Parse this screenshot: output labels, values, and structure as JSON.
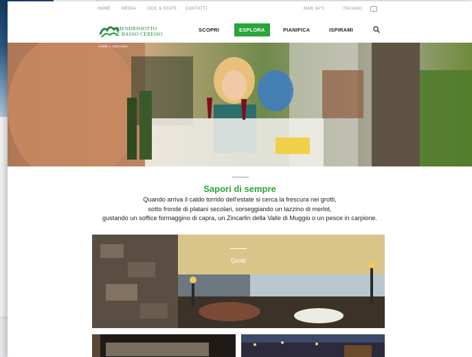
{
  "topbar": {
    "links": [
      "HOME",
      "MEDIA",
      "DOC & STATE",
      "CONTATTI"
    ],
    "weather": "MAR 24°C",
    "language": "ITALIANO"
  },
  "header": {
    "logo_line1": "MENDRISIOTTO",
    "logo_line2": "E BASSO CERESIO",
    "nav": [
      "SCOPRI",
      "ESPLORA",
      "PIANIFICA",
      "ISPIRAMI"
    ],
    "active_nav": "ESPLORA"
  },
  "breadcrumb": [
    "HOME",
    "ESPLORA"
  ],
  "breadcrumb_text": "HOME  >  ESPLORA",
  "main": {
    "title": "Sapori di sempre",
    "intro_lines": [
      "Quando arriva il caldo torrido dell'estate si cerca la frescura nei grotti,",
      "sotto fronde di platani secolari, sorseggiando un tazzino di merlot,",
      "gustando un soffice formaggino di capra, un Zincarlin della Valle di Muggio o un pesce in carpione."
    ]
  },
  "cards": [
    {
      "label": "Grotti"
    }
  ],
  "colors": {
    "accent": "#2aa53a",
    "text": "#222222",
    "topbar_text": "#8a8f95"
  },
  "icons": [
    "search-icon",
    "weather-icon",
    "chat-icon",
    "logo-mark"
  ]
}
